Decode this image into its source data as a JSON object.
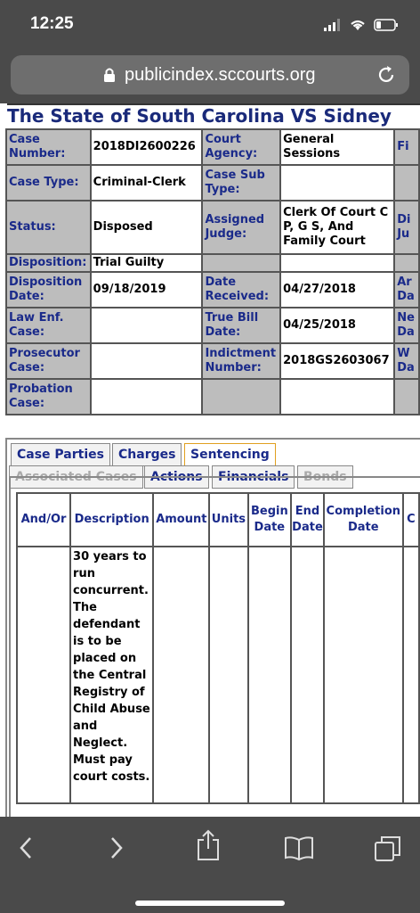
{
  "status_bar": {
    "time": "12:25"
  },
  "browser": {
    "url": "publicindex.sccourts.org"
  },
  "case": {
    "title": "The State of South Carolina VS Sidney",
    "case_number_label": "Case Number:",
    "case_number": "2018DI2600226",
    "court_agency_label": "Court Agency:",
    "court_agency": "General Sessions",
    "filed_label": "Fi",
    "case_type_label": "Case Type:",
    "case_type": "Criminal-Clerk",
    "case_sub_type_label": "Case Sub Type:",
    "case_sub_type": "",
    "status_label": "Status:",
    "status": "Disposed",
    "assigned_judge_label": "Assigned Judge:",
    "assigned_judge": "Clerk Of Court C P, G S, And Family Court",
    "di_label": "Di Ju",
    "disposition_label": "Disposition:",
    "disposition": "Trial Guilty",
    "disposition_date_label": "Disposition Date:",
    "disposition_date": "09/18/2019",
    "date_received_label": "Date Received:",
    "date_received": "04/27/2018",
    "ar_label": "Ar Da",
    "law_enf_label": "Law Enf. Case:",
    "law_enf": "",
    "true_bill_label": "True Bill Date:",
    "true_bill": "04/25/2018",
    "ne_label": "Ne Da",
    "prosecutor_label": "Prosecutor Case:",
    "prosecutor": "",
    "indictment_label": "Indictment Number:",
    "indictment": "2018GS2603067",
    "wa_label": "W Da",
    "probation_label": "Probation Case:",
    "probation": ""
  },
  "tabs": {
    "row1": [
      "Case Parties",
      "Charges",
      "Sentencing"
    ],
    "row2": [
      "Associated Cases",
      "Actions",
      "Financials",
      "Bonds"
    ],
    "active": "Sentencing"
  },
  "sentencing": {
    "headers": [
      "And/Or",
      "Description",
      "Amount",
      "Units",
      "Begin Date",
      "End Date",
      "Completion Date",
      "C"
    ],
    "row": {
      "and_or": "",
      "description": "30 years to run concurrent. The defendant is to be placed on the Central Registry of Child Abuse and Neglect. Must pay court costs.",
      "amount": "",
      "units": "",
      "begin": "",
      "end": "",
      "completion": ""
    }
  },
  "colors": {
    "label_bg": "#bdbdbd",
    "label_text": "#1a2a8a",
    "chrome": "#4a4a4a"
  }
}
